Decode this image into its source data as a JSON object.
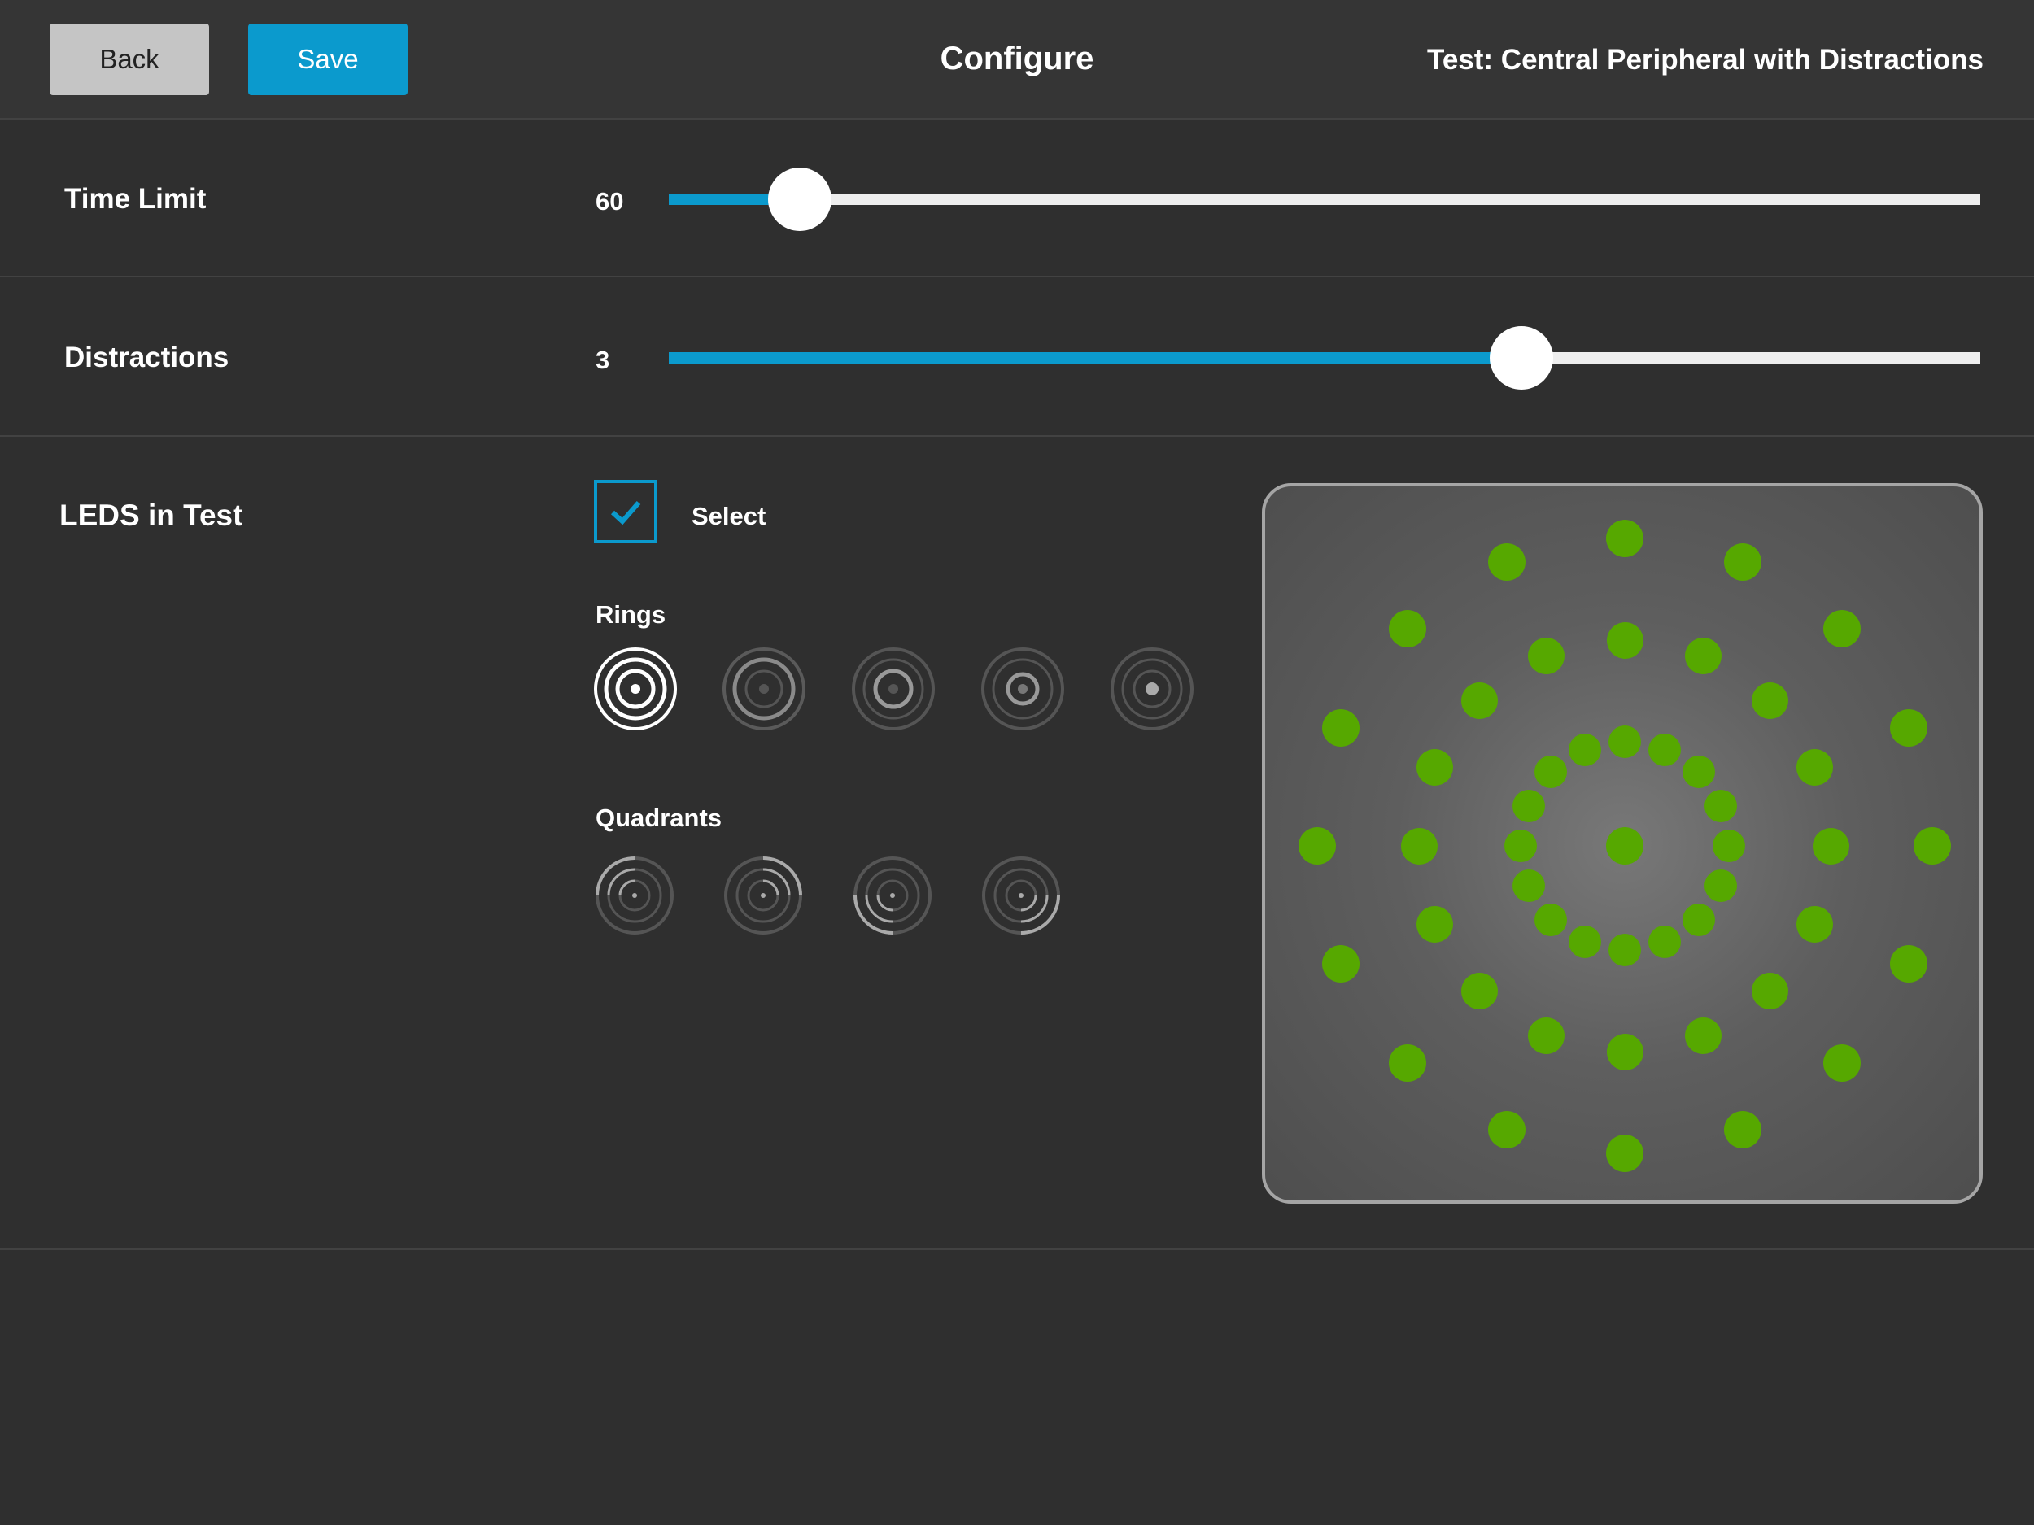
{
  "header": {
    "back_label": "Back",
    "save_label": "Save",
    "title": "Configure",
    "test_name": "Test: Central Peripheral with Distractions"
  },
  "time_limit": {
    "label": "Time Limit",
    "value": "60",
    "level": 0.1
  },
  "distractions": {
    "label": "Distractions",
    "value": "3",
    "level": 0.65
  },
  "leds": {
    "label": "LEDS in Test",
    "select_label": "Select",
    "select_checked": true,
    "rings_label": "Rings",
    "quadrants_label": "Quadrants",
    "selected_ring": 0,
    "led_color": "#56a800"
  },
  "colors": {
    "accent": "#0b9acd",
    "background": "#2f2f2f",
    "header": "#353535"
  }
}
